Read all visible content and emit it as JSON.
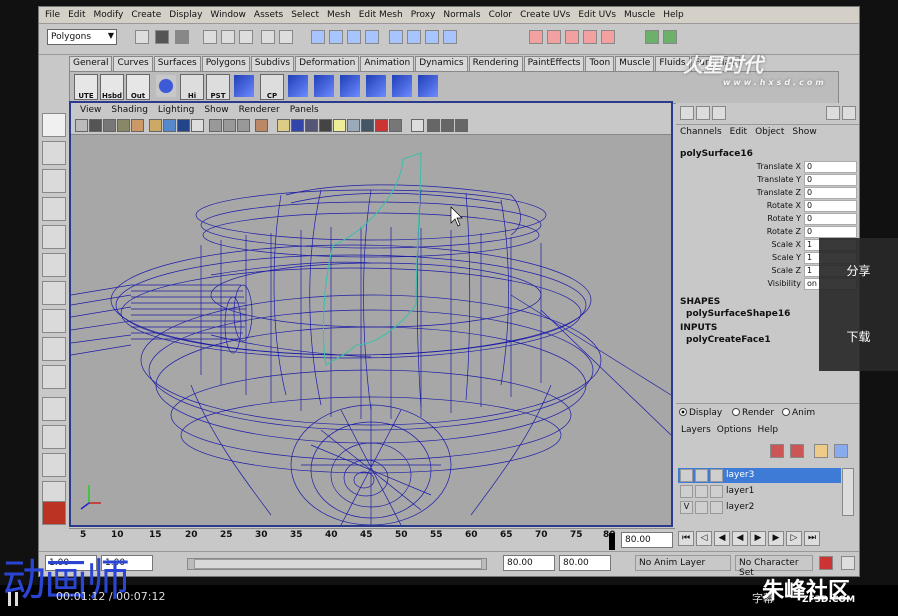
{
  "menubar": [
    "File",
    "Edit",
    "Modify",
    "Create",
    "Display",
    "Window",
    "Assets",
    "Select",
    "Mesh",
    "Edit Mesh",
    "Proxy",
    "Normals",
    "Color",
    "Create UVs",
    "Edit UVs",
    "Muscle",
    "Help"
  ],
  "status": {
    "mode": "Polygons"
  },
  "shelf_tabs": [
    "General",
    "Curves",
    "Surfaces",
    "Polygons",
    "Subdivs",
    "Deformation",
    "Animation",
    "Dynamics",
    "Rendering",
    "PaintEffects",
    "Toon",
    "Muscle",
    "Fluids",
    "Fur",
    "Hair"
  ],
  "shelf_buttons": [
    "UTE",
    "Hsbd",
    "Out",
    "Hi",
    "PST",
    "CP"
  ],
  "viewport": {
    "menu": [
      "View",
      "Shading",
      "Lighting",
      "Show",
      "Renderer",
      "Panels"
    ]
  },
  "channelbox": {
    "menu": [
      "Channels",
      "Edit",
      "Object",
      "Show"
    ],
    "object": "polySurface16",
    "attributes": [
      {
        "name": "Translate X",
        "value": "0"
      },
      {
        "name": "Translate Y",
        "value": "0"
      },
      {
        "name": "Translate Z",
        "value": "0"
      },
      {
        "name": "Rotate X",
        "value": "0"
      },
      {
        "name": "Rotate Y",
        "value": "0"
      },
      {
        "name": "Rotate Z",
        "value": "0"
      },
      {
        "name": "Scale X",
        "value": "1"
      },
      {
        "name": "Scale Y",
        "value": "1"
      },
      {
        "name": "Scale Z",
        "value": "1"
      },
      {
        "name": "Visibility",
        "value": "on"
      }
    ],
    "shapes_label": "SHAPES",
    "shape": "polySurfaceShape16",
    "inputs_label": "INPUTS",
    "input": "polyCreateFace1"
  },
  "layers": {
    "modes": [
      "Display",
      "Render",
      "Anim"
    ],
    "menu": [
      "Layers",
      "Options",
      "Help"
    ],
    "rows": [
      {
        "name": "layer3",
        "vis": "",
        "selected": true
      },
      {
        "name": "layer1",
        "vis": "",
        "selected": false
      },
      {
        "name": "layer2",
        "vis": "V",
        "selected": false
      }
    ]
  },
  "timeline": {
    "ticks": [
      "5",
      "10",
      "15",
      "20",
      "25",
      "30",
      "35",
      "40",
      "45",
      "50",
      "55",
      "60",
      "65",
      "70",
      "75",
      "80"
    ],
    "current": "80.00"
  },
  "range": {
    "start": "1.00",
    "inner_start": "1.00",
    "end": "80.00",
    "end2": "80.00",
    "anim_layer": "No Anim Layer",
    "char_set": "No Character Set"
  },
  "side_buttons": [
    "分享",
    "下载"
  ],
  "player": {
    "timecode": "00:01:12 / 00:07:12",
    "subs": "字幕"
  },
  "watermark": {
    "brand": "动画师",
    "site": "朱峰社区",
    "site_url": "ZF3D.COM",
    "corner": "火星时代",
    "corner_url": "www.hxsd.com"
  }
}
